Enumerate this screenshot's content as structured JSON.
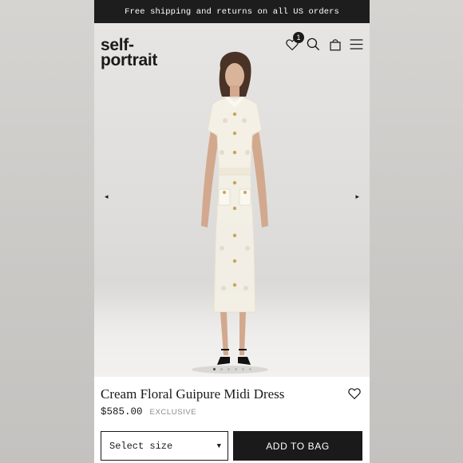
{
  "promo": {
    "text": "Free shipping and returns on all US orders"
  },
  "brand": {
    "line1": "self-",
    "line2": "portrait"
  },
  "header": {
    "wishlist_icon": "heart-icon",
    "wishlist_count": "1",
    "search_icon": "search-icon",
    "bag_icon": "shopping-bag-icon",
    "menu_icon": "hamburger-menu-icon"
  },
  "gallery": {
    "prev_arrow": "◂",
    "next_arrow": "▸",
    "total_images": 6,
    "active_index": 0
  },
  "product": {
    "title": "Cream Floral Guipure Midi Dress",
    "price": "$585.00",
    "tag": "EXCLUSIVE"
  },
  "actions": {
    "size_placeholder": "Select size",
    "size_caret": "▼",
    "add_to_bag": "ADD TO BAG"
  },
  "colors": {
    "promo_bg": "#1d1d1d",
    "button_bg": "#1a1a1a",
    "dress": "#f4f0e6",
    "buttons_gold": "#c9a45c"
  }
}
